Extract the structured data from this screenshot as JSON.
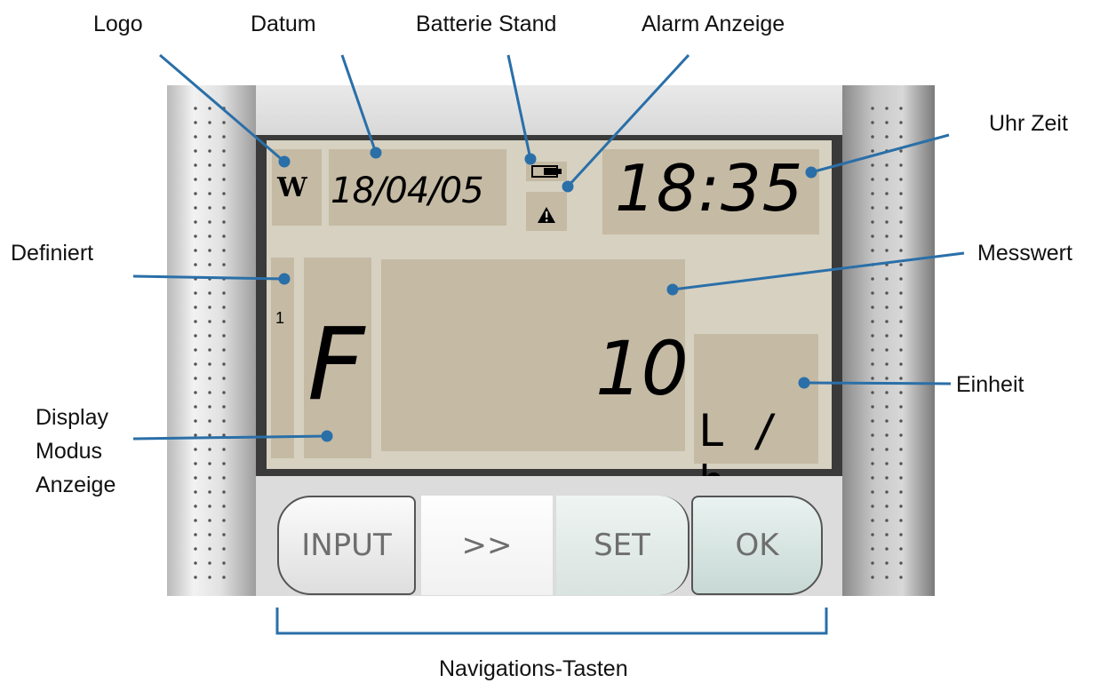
{
  "labels": {
    "logo": "Logo",
    "datum": "Datum",
    "batterie": "Batterie Stand",
    "alarm": "Alarm Anzeige",
    "uhrzeit": "Uhr Zeit",
    "definiert": "Definiert",
    "messwert": "Messwert",
    "einheit": "Einheit",
    "display_modus": [
      "Display",
      "Modus",
      "Anzeige"
    ],
    "navigation": "Navigations-Tasten"
  },
  "display": {
    "logo_text": "W",
    "date": "18/04/05",
    "time": "18:35",
    "defined_number": "1",
    "mode": "F",
    "value": "10",
    "unit": "L / h"
  },
  "buttons": [
    "INPUT",
    ">>",
    "SET",
    "OK"
  ],
  "colors": {
    "callout_line": "#2a6fa8",
    "lcd_background": "#d6d1c1",
    "lcd_segment": "#c5baa4"
  },
  "icons": {
    "battery": "battery-icon",
    "alarm": "warning-triangle-icon"
  }
}
